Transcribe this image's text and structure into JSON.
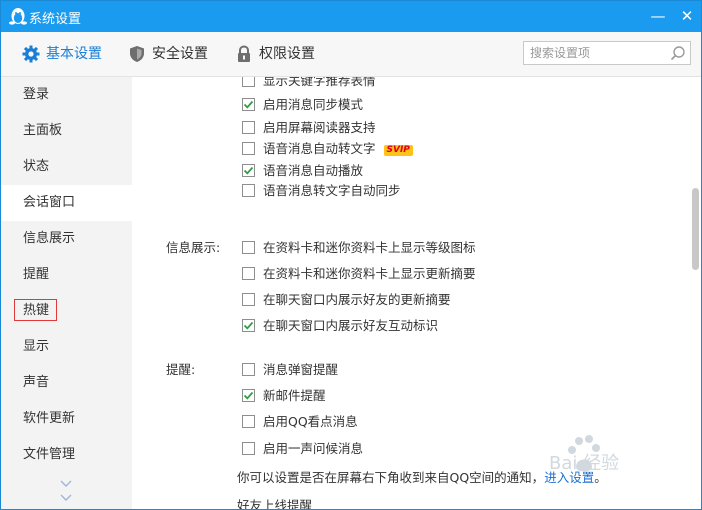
{
  "window": {
    "title": "系统设置",
    "min_label": "—",
    "close_label": "✕"
  },
  "tabs": [
    {
      "label": "基本设置",
      "icon": "gear-icon",
      "active": true
    },
    {
      "label": "安全设置",
      "icon": "shield-icon",
      "active": false
    },
    {
      "label": "权限设置",
      "icon": "lock-icon",
      "active": false
    }
  ],
  "search": {
    "placeholder": "搜索设置项",
    "value": ""
  },
  "sidebar": {
    "items": [
      {
        "label": "登录"
      },
      {
        "label": "主面板"
      },
      {
        "label": "状态"
      },
      {
        "label": "会话窗口",
        "active": true
      },
      {
        "label": "信息展示"
      },
      {
        "label": "提醒"
      },
      {
        "label": "热键",
        "highlighted": true
      },
      {
        "label": "显示"
      },
      {
        "label": "声音"
      },
      {
        "label": "软件更新"
      },
      {
        "label": "文件管理"
      }
    ]
  },
  "content": {
    "session_rows": [
      {
        "label": "显示关键字推荐表情",
        "checked": false,
        "partial": true
      },
      {
        "label": "启用消息同步模式",
        "checked": true
      },
      {
        "label": "启用屏幕阅读器支持",
        "checked": false
      },
      {
        "label": "语音消息自动转文字",
        "checked": false,
        "badge": "SVIP"
      },
      {
        "label": "语音消息自动播放",
        "checked": true
      },
      {
        "label": "语音消息转文字自动同步",
        "checked": false
      }
    ],
    "info_group": {
      "title": "信息展示:",
      "rows": [
        {
          "label": "在资料卡和迷你资料卡上显示等级图标",
          "checked": false
        },
        {
          "label": "在资料卡和迷你资料卡上显示更新摘要",
          "checked": false
        },
        {
          "label": "在聊天窗口内展示好友的更新摘要",
          "checked": false
        },
        {
          "label": "在聊天窗口内展示好友互动标识",
          "checked": true
        }
      ]
    },
    "remind_group": {
      "title": "提醒:",
      "rows": [
        {
          "label": "消息弹窗提醒",
          "checked": false
        },
        {
          "label": "新邮件提醒",
          "checked": true
        },
        {
          "label": "启用QQ看点消息",
          "checked": false
        },
        {
          "label": "启用一声问候消息",
          "checked": false
        }
      ]
    },
    "notice_text": "你可以设置是否在屏幕右下角收到来自QQ空间的通知，",
    "notice_link": "进入设置",
    "notice_end": "。",
    "friend_online": "好友上线提醒"
  },
  "watermark_text": "Bai 经验",
  "colors": {
    "accent": "#1b9bf0",
    "link": "#1b6fd1",
    "check": "#2e9e44",
    "badge_bg": "#ffc21a",
    "highlight_border": "#e03a3a"
  }
}
